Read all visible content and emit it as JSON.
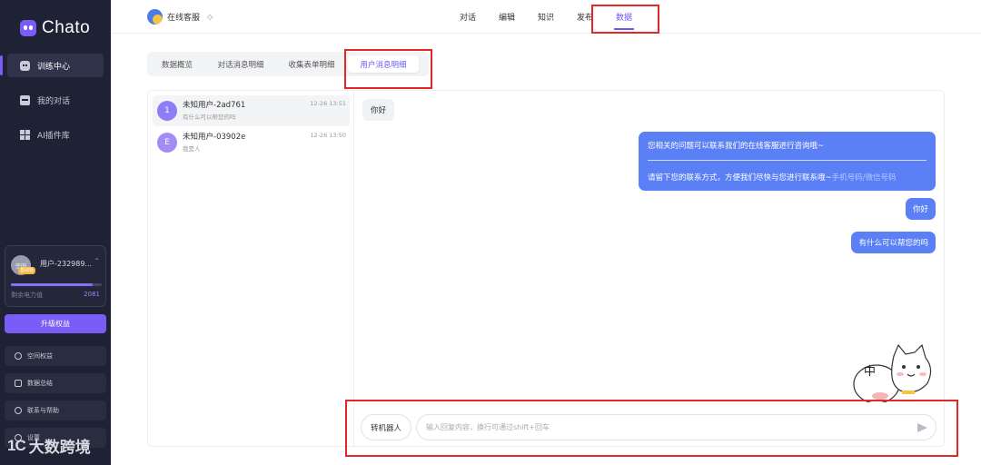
{
  "app": {
    "brand": "Chato"
  },
  "sidebar": {
    "items": [
      {
        "label": "训练中心",
        "icon": "robot-icon",
        "active": true
      },
      {
        "label": "我的对话",
        "icon": "chat-icon",
        "active": false
      },
      {
        "label": "AI插件库",
        "icon": "plugin-grid-icon",
        "active": false
      }
    ],
    "user": {
      "avatar_text": "空间",
      "badge": "基础版",
      "name": "用户-232989...",
      "power_label": "剩余电力值",
      "power_value": "2081",
      "power_fraction": 0.9
    },
    "upgrade_label": "升级权益",
    "links": [
      {
        "label": "空间权益",
        "icon": "shield-icon"
      },
      {
        "label": "数据总结",
        "icon": "cart-icon"
      },
      {
        "label": "联系与帮助",
        "icon": "help-icon"
      },
      {
        "label": "设置",
        "icon": "gear-icon"
      }
    ],
    "watermark": {
      "mark": "1C",
      "text": "大数跨境"
    }
  },
  "header": {
    "bot_name": "在线客服",
    "nav": [
      "对话",
      "编辑",
      "知识",
      "发布",
      "数据"
    ],
    "active_nav": "数据"
  },
  "subtabs": {
    "items": [
      "数据概览",
      "对话消息明细",
      "收集表单明细",
      "用户消息明细"
    ],
    "active": "用户消息明细"
  },
  "conversations": [
    {
      "avatar": "1",
      "name": "未知用户-2ad761",
      "preview": "有什么可以帮您的吗",
      "time": "12-26 13:51",
      "selected": true
    },
    {
      "avatar": "E",
      "name": "未知用户-03902e",
      "preview": "我是人",
      "time": "12-26 13:50",
      "selected": false
    }
  ],
  "chat": {
    "incoming": [
      "你好"
    ],
    "outgoing_long": {
      "line1": "您相关的问题可以联系我们的在线客服进行咨询哦~",
      "line2": "请留下您的联系方式，方便我们尽快与您进行联系哦~",
      "line2_link": "手机号码/微信号码"
    },
    "outgoing": [
      "你好",
      "有什么可以帮您的吗"
    ],
    "sticker_text": "中"
  },
  "composer": {
    "transfer_label": "转机器人",
    "placeholder": "输入回复内容，换行可通过shift+回车"
  },
  "colors": {
    "accent": "#6b5cf6",
    "bubble": "#5b7ff5",
    "sidebar": "#1f2134",
    "highlight": "#e32626"
  }
}
